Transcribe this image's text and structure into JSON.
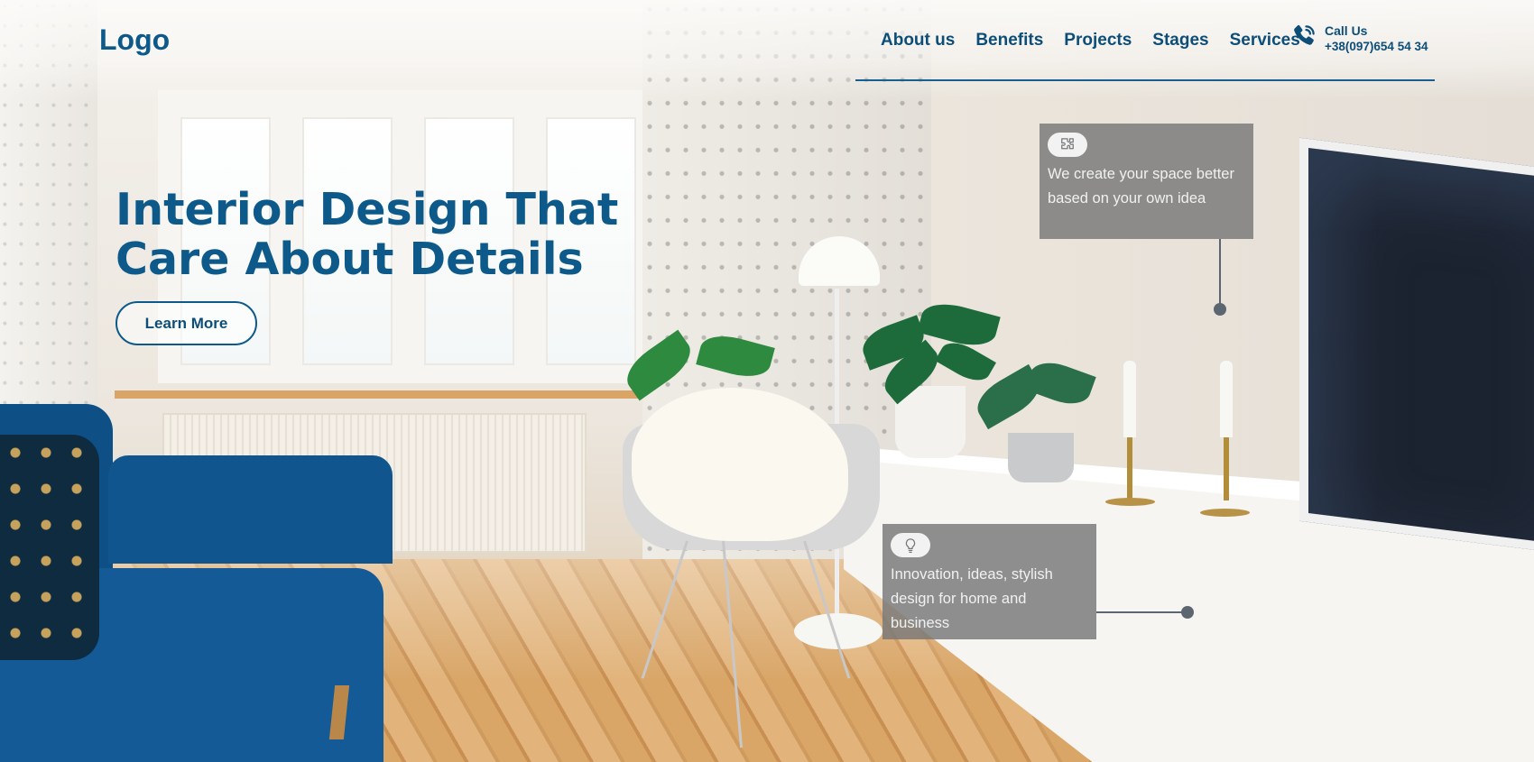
{
  "header": {
    "logo": "Logo",
    "nav": [
      "About us",
      "Benefits",
      "Projects",
      "Stages",
      "Services"
    ],
    "call_label": "Call Us",
    "phone": "+38(097)654 54 34"
  },
  "hero": {
    "title_line1": "Interior Design That",
    "title_line2": "Care About Details",
    "cta": "Learn More"
  },
  "callouts": [
    {
      "icon": "puzzle-icon",
      "line1": "We create your space better",
      "line2": "based on your own idea"
    },
    {
      "icon": "lightbulb-icon",
      "line1": "Innovation, ideas, stylish",
      "line2": "design for home and",
      "line3": "business"
    }
  ],
  "colors": {
    "brand_blue": "#0d5a8a",
    "callout_bg": "#7a7a7a",
    "connector": "#5c6670"
  }
}
